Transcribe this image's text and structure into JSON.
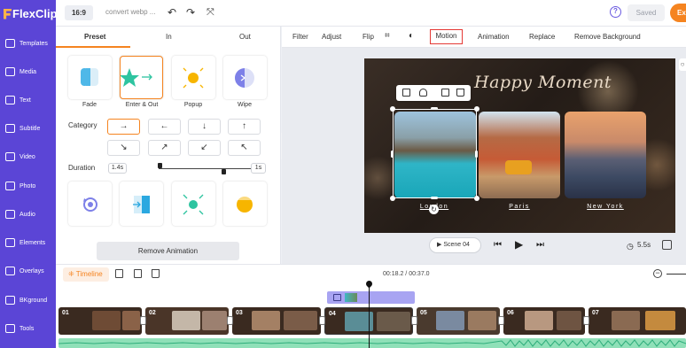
{
  "app": {
    "logo": "FlexClip"
  },
  "sidebar": {
    "items": [
      {
        "label": "Templates",
        "icon": "templates-icon"
      },
      {
        "label": "Media",
        "icon": "media-icon"
      },
      {
        "label": "Text",
        "icon": "text-icon"
      },
      {
        "label": "Subtitle",
        "icon": "subtitle-icon"
      },
      {
        "label": "Video",
        "icon": "video-icon"
      },
      {
        "label": "Photo",
        "icon": "photo-icon"
      },
      {
        "label": "Audio",
        "icon": "audio-icon"
      },
      {
        "label": "Elements",
        "icon": "elements-icon"
      },
      {
        "label": "Overlays",
        "icon": "overlays-icon"
      },
      {
        "label": "BKground",
        "icon": "background-icon"
      },
      {
        "label": "Tools",
        "icon": "tools-icon"
      }
    ]
  },
  "header": {
    "ratio": "16:9",
    "project_name": "convert webp ...",
    "saved_label": "Saved",
    "export_label": "Ex"
  },
  "panel": {
    "tabs": [
      "Preset",
      "In",
      "Out"
    ],
    "active_tab": "Preset",
    "animations_top": [
      "Fade",
      "Enter & Out",
      "Popup",
      "Wipe"
    ],
    "selected_animation": "Enter & Out",
    "category_label": "Category",
    "directions": [
      "→",
      "←",
      "↓",
      "↑",
      "↘",
      "↗",
      "↙",
      "↖"
    ],
    "selected_direction": "→",
    "duration_label": "Duration",
    "duration_start": "1.4s",
    "duration_end": "1s",
    "remove_label": "Remove Animation"
  },
  "toolbar": {
    "items": [
      "Filter",
      "Adjust",
      "Flip",
      "Motion",
      "Animation",
      "Replace",
      "Remove Background"
    ],
    "highlighted": "Motion"
  },
  "preview": {
    "title": "Happy Moment",
    "captions": [
      "London",
      "Paris",
      "New York"
    ]
  },
  "playback": {
    "scene_label": "Scene 04",
    "duration": "5.5s"
  },
  "timeline": {
    "label": "Timeline",
    "time": "00:18.2 / 00:37.0",
    "clips": [
      "01",
      "02",
      "03",
      "04",
      "05",
      "06",
      "07"
    ]
  },
  "colors": {
    "brand": "#5b45d6",
    "accent": "#f58420",
    "highlight": "#e53935"
  }
}
